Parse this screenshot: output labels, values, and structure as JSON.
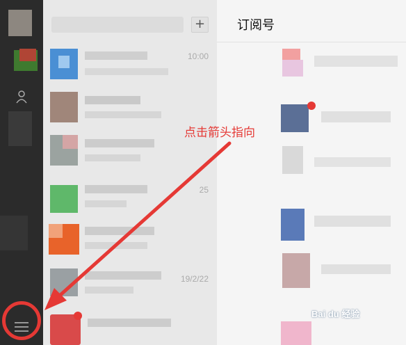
{
  "chat_list": {
    "add_button": "+",
    "items": [
      {
        "time": "10:00"
      },
      {
        "time": ""
      },
      {
        "time": ""
      },
      {
        "time": "25"
      },
      {
        "time": ""
      },
      {
        "time": "19/2/22"
      },
      {
        "time": ""
      }
    ]
  },
  "right_panel": {
    "title": "订阅号"
  },
  "annotation": {
    "text": "点击箭头指向",
    "color": "#e53935"
  },
  "watermark": {
    "text": "Bai du 经验"
  },
  "icons": [
    "avatar",
    "chat-icon",
    "contacts-icon",
    "favorites-icon",
    "menu-icon"
  ]
}
